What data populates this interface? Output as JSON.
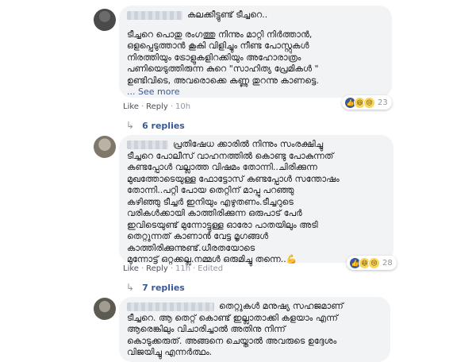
{
  "comments": [
    {
      "lines": [
        "കലക്കീട്ടുണ്ട് ടീച്ചറെ..",
        "ടീച്ചറെ പൊതു രംഗത്തു നിന്നും മാറ്റി നിർത്താൻ,",
        "ഒളപ്പെടുത്താൻ കൂകി വിളിച്ചും നീണ്ട പോസ്റ്റുകൾ",
        "നിരത്തിയും ട്രോളുകളിറക്കിയും അഹോരാത്രം",
        "പണിയെടുത്തിരുന്ന കുറെ \"സാഹിത്യ പ്രേമികൾ \"",
        "ഉണ്ടിവിടെ, അവരൊക്കെ കണ്ണു തുറന്നു കാണട്ടെ."
      ],
      "see_more": "... See more",
      "like": "Like",
      "reply": "Reply",
      "time": "10h",
      "reaction_count": "23",
      "replies": "6 replies"
    },
    {
      "lines": [
        "പ്രതിഷേധ ക്കാരിൽ നിന്നും സംരക്ഷിച്ചു",
        "ടീച്ചറെ പോലീസ് വാഹനത്തിൽ കൊണ്ടു പോകുന്നത്",
        "കണ്ടപ്പോൾ വല്ലാത്ത വിഷമം തോന്നി..ചിരിക്കുന്ന",
        "മുഖത്തോടെയുള്ള ഫോട്ടോസ് കണ്ടപ്പോൾ സന്തോഷം",
        "തോന്നി..പറ്റി പോയ തെറ്റിന് മാപ്പു പറഞ്ഞു",
        "കഴിഞ്ഞു ടീച്ചർ ഇനിയും എഴുതണം.ടീച്ചറുടെ",
        "വരികൾക്കായി കാത്തിരിക്കുന്ന ഒരുപാട് പേർ",
        "ഇവിടെയുണ്ട് മുന്നോട്ടുള്ള ഓരോ പാതയിലും അടി",
        "തെറ്റുന്നത് കാണാൻ വേട്ട മൃഗങ്ങൾ",
        "കാത്തിരിക്കുന്നുണ്ട്.ധീരതയോടെ",
        "മുന്നോട്ട് ഒറ്റക്കല്ല.നമ്മൾ ഒരുമിച്ചു തന്നെ.."
      ],
      "like": "Like",
      "reply": "Reply",
      "time": "11h",
      "edited": "Edited",
      "reaction_count": "28",
      "replies": "7 replies"
    },
    {
      "lines": [
        "തെറ്റുകൾ മനുഷ്യ സഹജമാണ്",
        "ടീച്ചറെ. ആ തെറ്റ് കൊണ്ട് ഇല്ലാതാക്കി കളയാം എന്ന്",
        "ആരെങ്കിലും വിചാരിച്ചാൽ അതിനു നിന്ന്",
        "കൊടുക്കരുത്. അങ്ങനെ ചെയ്താൽ അവരുടെ ഉദ്ദേശം",
        "വിജയിച്ചു എന്നർത്ഥം."
      ]
    }
  ],
  "icons": {
    "like": "thumbs-up",
    "haha": "laughing-face",
    "sad": "sad-face",
    "flex": "flexed-biceps",
    "reply_arrow": "reply-arrow"
  },
  "colors": {
    "bubble": "#f2f3f5",
    "link": "#385898",
    "meta": "#90949c",
    "like_blue": "#3b5998"
  }
}
